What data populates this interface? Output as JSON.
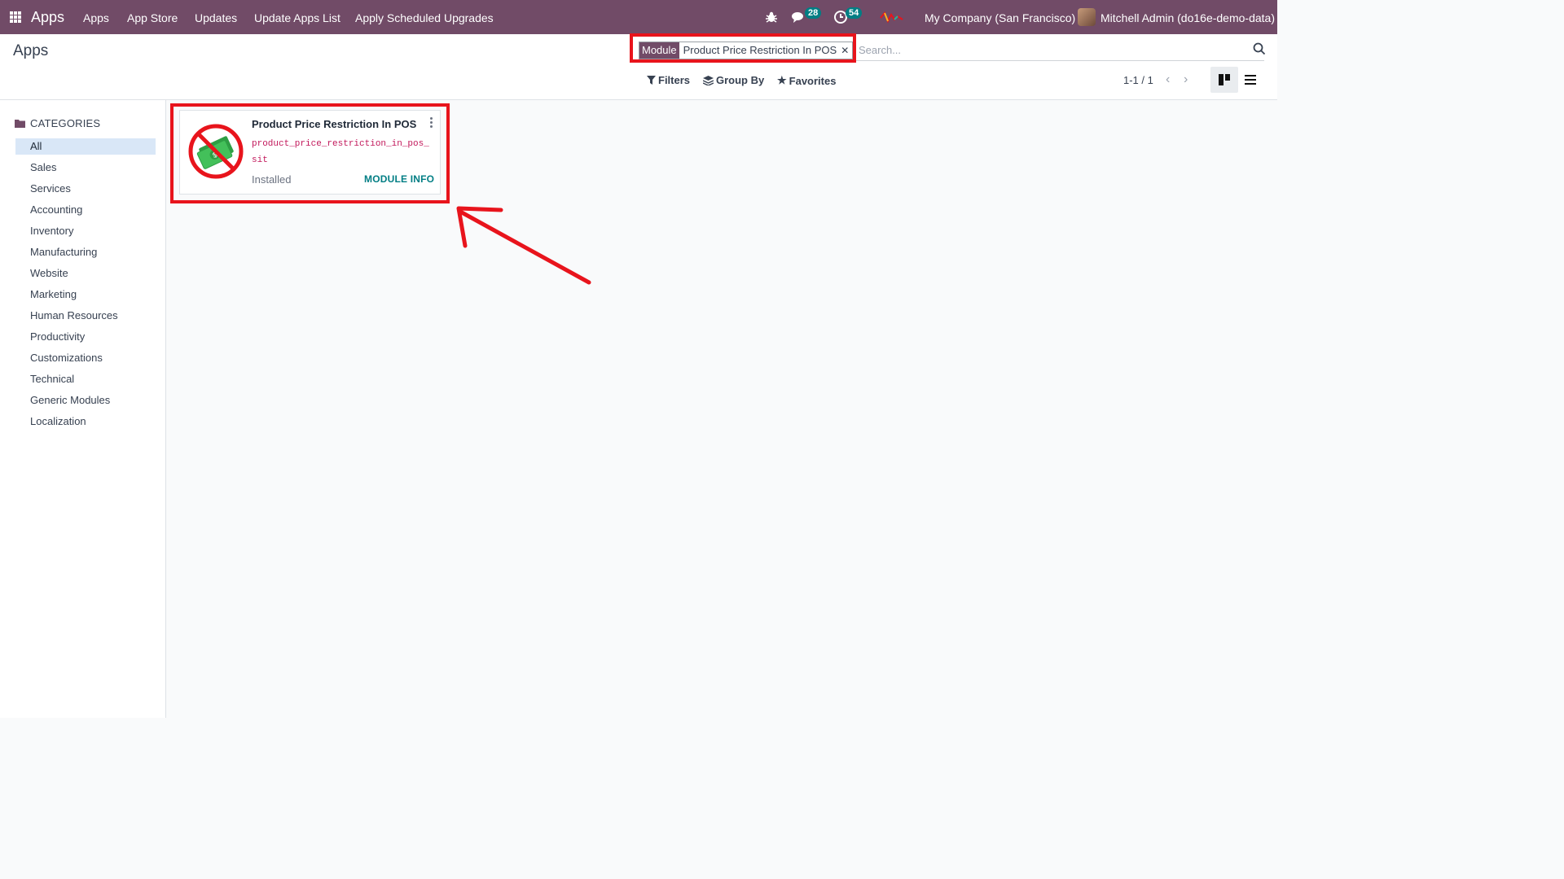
{
  "navbar": {
    "brand": "Apps",
    "menu": [
      "Apps",
      "App Store",
      "Updates",
      "Update Apps List",
      "Apply Scheduled Upgrades"
    ],
    "messages_count": "28",
    "activities_count": "54",
    "company": "My Company (San Francisco)",
    "user": "Mitchell Admin (do16e-demo-data)",
    "icons": [
      "apps-grid-icon",
      "bug-icon",
      "chat-icon",
      "clock-icon",
      "voip-icon"
    ]
  },
  "control_panel": {
    "title": "Apps",
    "search": {
      "facet_label": "Module",
      "facet_value": "Product Price Restriction In POS",
      "placeholder": "Search..."
    },
    "filters_label": "Filters",
    "group_by_label": "Group By",
    "favorites_label": "Favorites",
    "pager": "1-1 / 1"
  },
  "sidebar": {
    "header": "CATEGORIES",
    "items": [
      "All",
      "Sales",
      "Services",
      "Accounting",
      "Inventory",
      "Manufacturing",
      "Website",
      "Marketing",
      "Human Resources",
      "Productivity",
      "Customizations",
      "Technical",
      "Generic Modules",
      "Localization"
    ],
    "active": "All"
  },
  "card": {
    "title": "Product Price Restriction In POS",
    "technical_name": "product_price_restriction_in_pos_sit",
    "status": "Installed",
    "info_button": "MODULE INFO"
  },
  "colors": {
    "brand": "#714b67",
    "accent": "#017e84",
    "highlight": "#e8141c"
  }
}
